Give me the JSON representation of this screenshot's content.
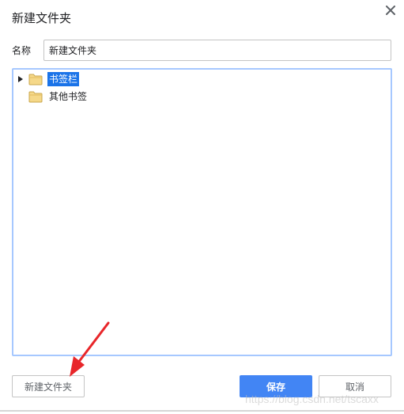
{
  "dialog": {
    "title": "新建文件夹",
    "close_icon": "close-icon"
  },
  "name_field": {
    "label": "名称",
    "value": "新建文件夹"
  },
  "tree": {
    "items": [
      {
        "label": "书签栏",
        "icon": "folder-icon",
        "expanded": false,
        "has_children": true,
        "selected": true
      },
      {
        "label": "其他书签",
        "icon": "folder-icon",
        "has_children": false,
        "selected": false
      }
    ]
  },
  "buttons": {
    "new_folder": "新建文件夹",
    "save": "保存",
    "cancel": "取消"
  },
  "watermark": "https://blog.csdn.net/tscaxx",
  "colors": {
    "accent": "#4285f4",
    "selection": "#1a73e8",
    "tree_border": "#a6c8ff",
    "folder_fill": "#f5d889",
    "folder_stroke": "#c9a64a",
    "annotation_arrow": "#e8262a"
  }
}
